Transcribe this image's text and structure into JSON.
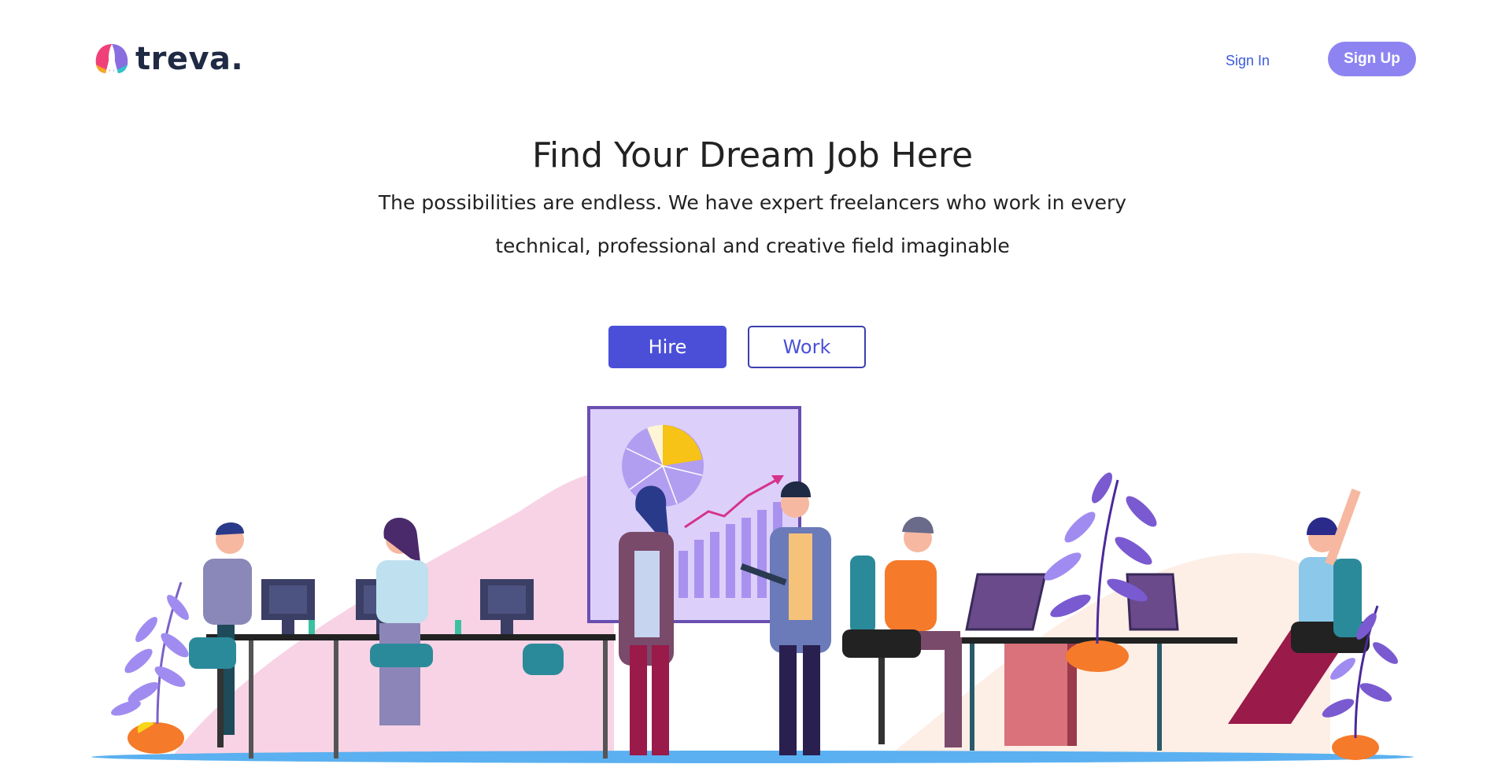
{
  "header": {
    "logo_text": "treva.",
    "sign_in_label": "Sign In",
    "sign_up_label": "Sign Up"
  },
  "hero": {
    "title": "Find Your Dream Job Here",
    "subtitle": "The possibilities are endless. We have expert freelancers who work in every technical, professional and creative field imaginable",
    "hire_label": "Hire",
    "work_label": "Work"
  },
  "colors": {
    "accent": "#4b4fd8",
    "sign_up_bg": "#8d84f2",
    "link": "#3b5bdb",
    "blob_pink": "#f8d3e5",
    "plant_purple": "#8a6ee0",
    "board_bg": "#dcd0fb",
    "floor_blue": "#5ab0f0"
  },
  "icons": {
    "logo": "treva-logo-icon"
  }
}
